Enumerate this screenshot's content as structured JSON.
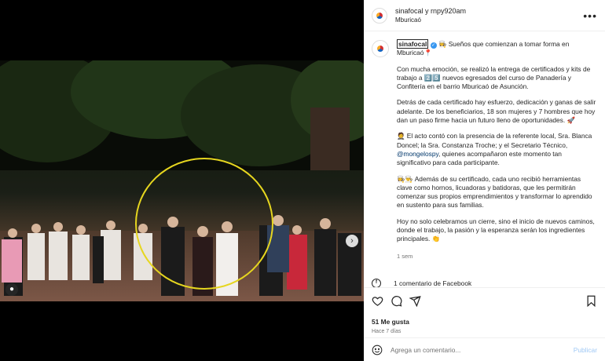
{
  "header": {
    "title": "sinafocal y rnpy920am",
    "location": "Mburicaó",
    "more_icon": "more-dots-icon"
  },
  "caption": {
    "username": "sinafocal",
    "title_text": " 👩‍🍳 Sueños que comienzan a tomar forma en Mburicaó📍",
    "p1": "Con mucha emoción, se realizó la entrega de certificados y kits de trabajo a 2️⃣5️⃣ nuevos egresados del curso de Panadería y Confitería en el barrio Mburicaó de Asunción.",
    "p2": "Detrás de cada certificado hay esfuerzo, dedicación y ganas de salir adelante. De los beneficiarios, 18 son mujeres y 7 hombres que hoy dan un paso firme hacia un futuro lleno de oportunidades. 🚀",
    "p3_before": "🤵 El acto contó con la presencia de la referente local, Sra. Blanca Doncel; la Sra. Constanza Troche; y el Secretario Técnico, ",
    "p3_mention": "@mongelospy",
    "p3_after": ", quienes acompañaron este momento tan significativo para cada participante.",
    "p4": "👩‍🍳👨‍🍳 Además de su certificado, cada uno recibió herramientas clave como hornos, licuadoras y batidoras, que les permitirán comenzar sus propios emprendimientos y transformar lo aprendido en sustento para sus familias.",
    "p5": "Hoy no solo celebramos un cierre, sino el inicio de nuevos caminos, donde el trabajo, la pasión y la esperanza serán los ingredientes principales. 👏",
    "time": "1 sem"
  },
  "facebook": {
    "comments": "1 comentario de Facebook",
    "icon_label": "f"
  },
  "actions": {
    "icons": [
      "heart-icon",
      "comment-icon",
      "share-icon",
      "bookmark-icon"
    ]
  },
  "likes": "51 Me gusta",
  "posted_ago": "Hace 7 días",
  "comment_box": {
    "placeholder": "Agrega un comentario...",
    "post_label": "Publicar"
  },
  "media": {
    "carousel_count": 15,
    "active_index": 0,
    "next_label": "›",
    "tag_icon": "user-tag-icon"
  },
  "colors": {
    "highlight_circle": "#e6d61f",
    "mention": "#00376b",
    "post_button": "#a0c9f5"
  }
}
